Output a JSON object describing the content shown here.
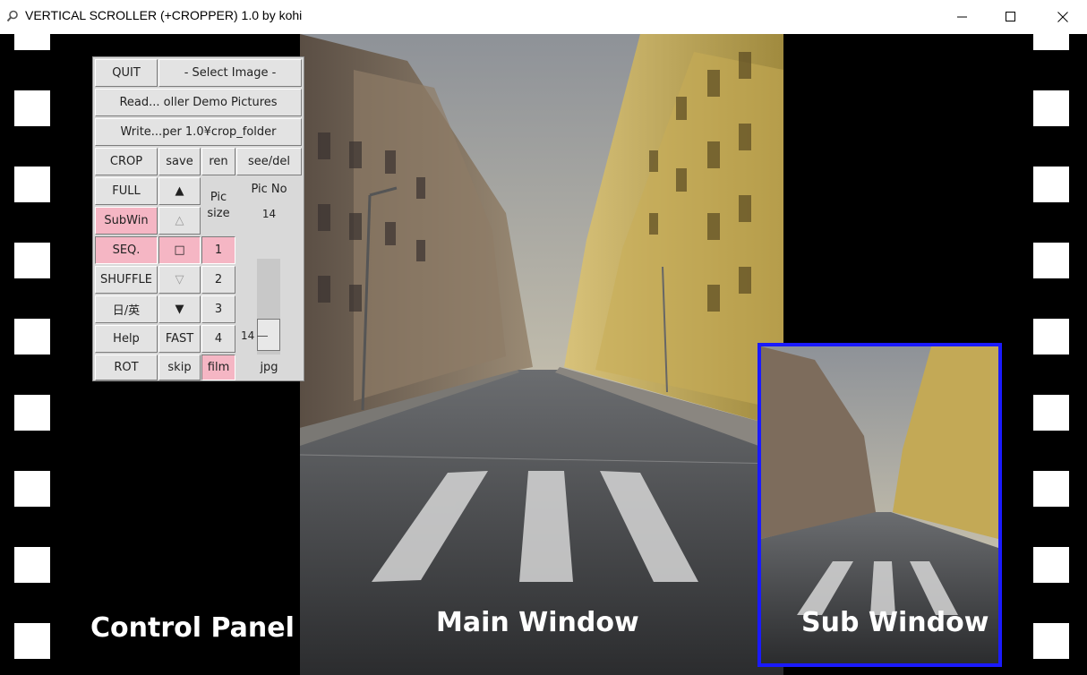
{
  "window": {
    "title": "VERTICAL SCROLLER (+CROPPER) 1.0 by kohi",
    "icon": "magnifier-icon",
    "controls": [
      "minimize-icon",
      "maximize-icon",
      "close-icon"
    ]
  },
  "labels": {
    "control_panel": "Control Panel",
    "main_window": "Main Window",
    "sub_window": "Sub Window"
  },
  "panel": {
    "quit": "QUIT",
    "select_image": "- Select Image -",
    "read_folder": "Read... oller Demo Pictures",
    "write_folder": "Write...per 1.0¥crop_folder",
    "crop": "CROP",
    "save": "save",
    "ren": "ren",
    "see_del": "see/del",
    "full": "FULL",
    "subwin": "SubWin",
    "seq": "SEQ.",
    "shuffle": "SHUFFLE",
    "lang": "日/英",
    "help": "Help",
    "rot": "ROT",
    "fast": "FAST",
    "skip": "skip",
    "pic_size_label": "Pic size",
    "size_1": "1",
    "size_2": "2",
    "size_3": "3",
    "size_4": "4",
    "film": "film",
    "pic_no_label": "Pic No",
    "pic_no_value": "14",
    "slider_value": "14",
    "format": "jpg",
    "up_filled": "▲",
    "up_hollow": "△",
    "square": "□",
    "down_hollow": "▽",
    "down_filled": "▼"
  },
  "colors": {
    "accent_pink": "#f5b6c4",
    "subwindow_border": "#1a1aff"
  }
}
